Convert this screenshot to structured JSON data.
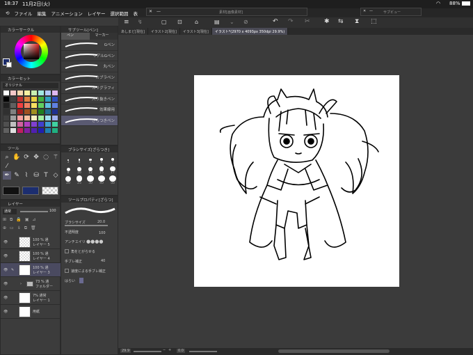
{
  "status": {
    "time": "18:37",
    "date": "11月2日(火)",
    "battery": "88%"
  },
  "menu": [
    "ファイル",
    "編集",
    "アニメーション",
    "レイヤー",
    "選択範囲",
    "表"
  ],
  "floating": {
    "left_title": "素材[画像素材]",
    "right_title": "サブビュー"
  },
  "tabs": [
    "あしまど[現在]",
    "イラスト2[現在]",
    "イラスト3[現在]",
    "イラスト*(2970 x 4093px 350dpi 29.9%)"
  ],
  "color_panel": {
    "title": "カラーサークル",
    "set_title": "カラーセット",
    "set_name": "オリジナル"
  },
  "colors": [
    "#ffffff",
    "#f4c8c8",
    "#f8d8b0",
    "#f8f0a0",
    "#c8f0b0",
    "#a0e8e0",
    "#b0c8f8",
    "#e0b8f0",
    "#000000",
    "#404040",
    "#c03030",
    "#e08040",
    "#e8d040",
    "#40b040",
    "#30a0c0",
    "#3050c0",
    "#202020",
    "#606060",
    "#f04040",
    "#f08060",
    "#f8e060",
    "#60d060",
    "#60c0e0",
    "#6080e0",
    "#303030",
    "#808080",
    "#a02020",
    "#a05020",
    "#a09020",
    "#208020",
    "#207090",
    "#203090",
    "#404040",
    "#a0a0a0",
    "#f8a0a0",
    "#f8c0a0",
    "#f8f0c0",
    "#a0f0a0",
    "#a0e0f0",
    "#a0b0f0",
    "#505050",
    "#c0c0c0",
    "#d060a0",
    "#b040c0",
    "#8040d0",
    "#4040d0",
    "#40a0d0",
    "#40d0a0",
    "#606060",
    "#e0e0e0",
    "#c02060",
    "#8020a0",
    "#5020b0",
    "#2020b0",
    "#2080b0",
    "#20b080"
  ],
  "subtool": {
    "title": "サブツール[ペン]",
    "tabs": [
      "ペン",
      "マーカー"
    ],
    "brushes": [
      "Gペン",
      "リアルGペン",
      "丸ペン",
      "カブラペン",
      "カリグラフィ",
      "入り抜きペン",
      "効果線用",
      "ざらつきペン"
    ]
  },
  "tool": {
    "title": "ツール"
  },
  "brush_size": {
    "title": "ブラシサイズ[ざらつき]",
    "sizes": [
      "3",
      "4",
      "5",
      "6",
      "7",
      "8",
      "10",
      "12",
      "15",
      "17",
      "20",
      "25",
      "30",
      "40",
      "50"
    ]
  },
  "tool_prop": {
    "title": "ツールプロパティ[ざらつ]",
    "brush_size_label": "ブラシサイズ",
    "brush_size_value": "20.0",
    "opacity_label": "不透明度",
    "opacity_value": "100",
    "aa_label": "アンチエイリ",
    "corner_label": "角をとがらせる",
    "stab_label": "手ブレ補正",
    "stab_value": "40",
    "speed_label": "速度による手ブレ補正",
    "fade_label": "はらい"
  },
  "layer": {
    "title": "レイヤー",
    "blend": "通常",
    "opacity": "100",
    "rows": [
      {
        "pct": "100 % 通",
        "name": "レイヤー 5"
      },
      {
        "pct": "100 % 通",
        "name": "レイヤー 4"
      },
      {
        "pct": "100 % 通",
        "name": "レイヤー 3"
      },
      {
        "pct": "73 % 通",
        "name": "フォルダー"
      },
      {
        "pct": "7% 通常",
        "name": "レイヤー 1"
      },
      {
        "pct": "",
        "name": "用紙"
      }
    ]
  },
  "bottom": {
    "zoom": "29.9",
    "angle": "0.0"
  }
}
